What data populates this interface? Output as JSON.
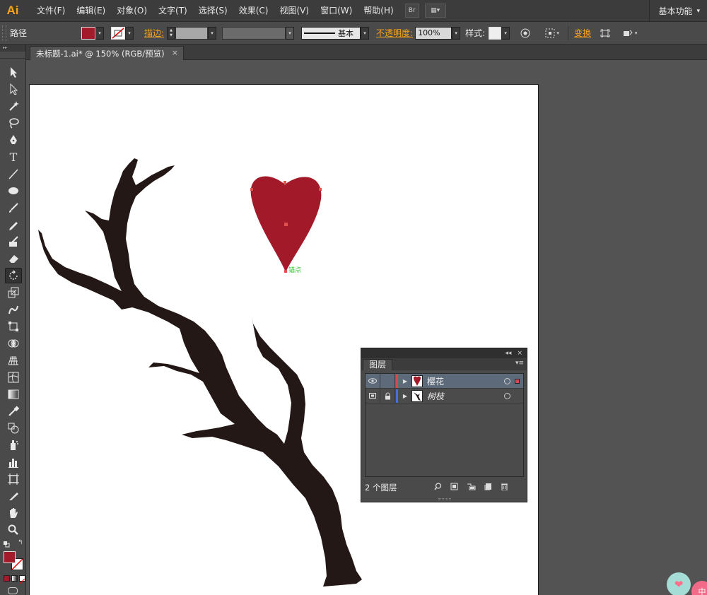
{
  "app": {
    "logo": "Ai"
  },
  "menu": [
    "文件(F)",
    "编辑(E)",
    "对象(O)",
    "文字(T)",
    "选择(S)",
    "效果(C)",
    "视图(V)",
    "窗口(W)",
    "帮助(H)"
  ],
  "menubar_buttons": {
    "bridge": "Br",
    "arrange": "▦▾"
  },
  "workspace": {
    "label": "基本功能",
    "arrow": "▾"
  },
  "control": {
    "object_type": "路径",
    "stroke_label": "描边:",
    "stroke_style": "基本",
    "opacity_label": "不透明度:",
    "opacity_value": "100%",
    "style_label": "样式:",
    "transform_label": "变换",
    "dropdown_arrow": "▾"
  },
  "colors": {
    "fill": "#a31b2a",
    "heart": "#a21a2a",
    "branch": "#231815",
    "anchor": "#e0504d",
    "anchor_label": "#33cc33",
    "layer1": "#d44a52",
    "layer2": "#4a6fd4"
  },
  "document": {
    "tab_title": "未标题-1.ai* @ 150% (RGB/预览)",
    "close": "×"
  },
  "artwork": {
    "anchor_label": "锚点"
  },
  "tools": [
    "selection-tool",
    "direct-selection-tool",
    "magic-wand-tool",
    "lasso-tool",
    "pen-tool",
    "type-tool",
    "line-tool",
    "ellipse-tool",
    "paintbrush-tool",
    "pencil-tool",
    "blob-brush-tool",
    "eraser-tool",
    "rotate-tool",
    "scale-tool",
    "warp-tool",
    "free-transform-tool",
    "shape-builder-tool",
    "perspective-grid-tool",
    "mesh-tool",
    "gradient-tool",
    "eyedropper-tool",
    "blend-tool",
    "symbol-sprayer-tool",
    "column-graph-tool",
    "artboard-tool",
    "slice-tool",
    "hand-tool",
    "zoom-tool"
  ],
  "layers_panel": {
    "tab": "图层",
    "collapse": "◂◂",
    "close": "×",
    "menu": "▾≡",
    "layers": [
      {
        "name": "樱花",
        "visibility": "●",
        "lock": "",
        "italic": false,
        "selected": true
      },
      {
        "name": "树枝",
        "visibility": "▭",
        "lock": "🔒",
        "italic": true,
        "selected": false
      }
    ],
    "count": "2 个图层",
    "footer_icons": [
      "search-icon",
      "clipping-mask-icon",
      "new-sublayer-icon",
      "new-layer-icon",
      "delete-icon"
    ]
  },
  "floating": {
    "heart": "❤",
    "b": "中"
  }
}
